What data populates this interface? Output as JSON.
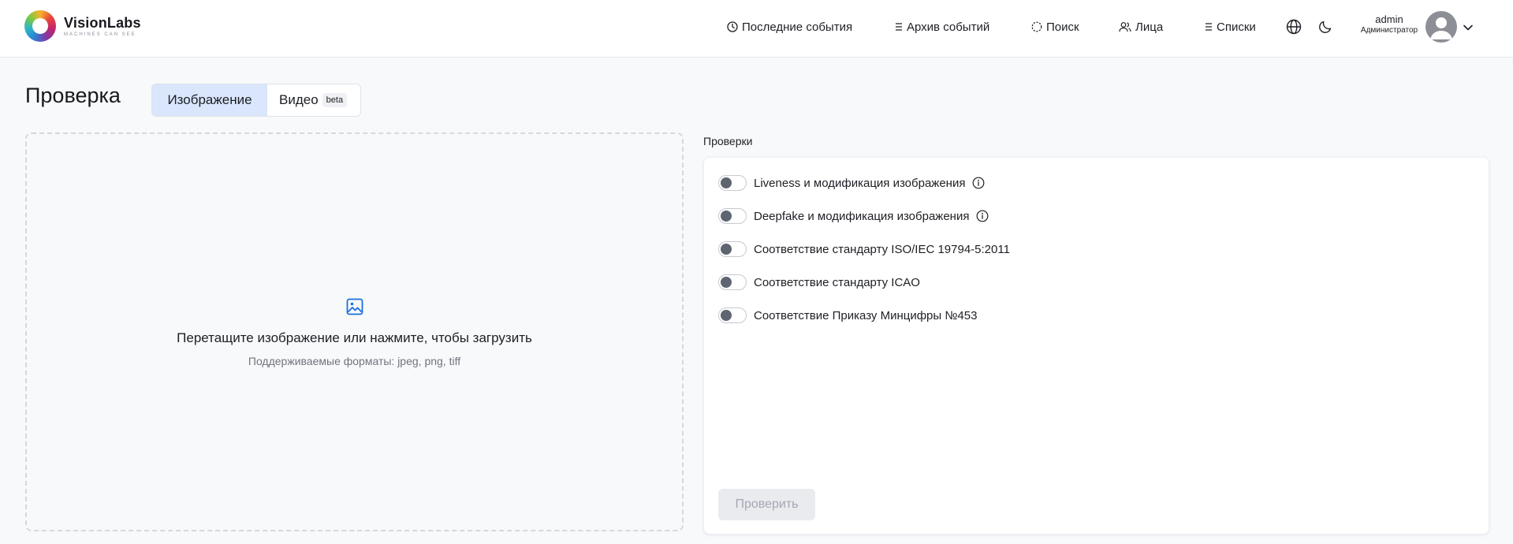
{
  "brand": {
    "name": "VisionLabs",
    "tagline": "MACHINES CAN SEE"
  },
  "nav": {
    "items": [
      {
        "label": "Последние события",
        "icon": "clock-icon"
      },
      {
        "label": "Архив событий",
        "icon": "list-icon"
      },
      {
        "label": "Поиск",
        "icon": "search-target-icon"
      },
      {
        "label": "Лица",
        "icon": "users-icon"
      },
      {
        "label": "Списки",
        "icon": "list-icon"
      }
    ],
    "language_icon": "globe-icon",
    "theme_icon": "moon-icon"
  },
  "user": {
    "name": "admin",
    "role": "Администратор"
  },
  "page": {
    "title": "Проверка",
    "tabs": [
      {
        "label": "Изображение",
        "active": true
      },
      {
        "label": "Видео",
        "badge": "beta",
        "active": false
      }
    ]
  },
  "dropzone": {
    "icon": "image-icon",
    "text": "Перетащите изображение или нажмите, чтобы загрузить",
    "hint": "Поддерживаемые форматы: jpeg, png, tiff"
  },
  "checks": {
    "label": "Проверки",
    "items": [
      {
        "label": "Liveness и модификация изображения",
        "enabled": false,
        "info": true
      },
      {
        "label": "Deepfake и модификация изображения",
        "enabled": false,
        "info": true
      },
      {
        "label": "Соответствие стандарту ISO/IEC 19794-5:2011",
        "enabled": false,
        "info": false
      },
      {
        "label": "Соответствие стандарту ICAO",
        "enabled": false,
        "info": false
      },
      {
        "label": "Соответствие Приказу Минцифры №453",
        "enabled": false,
        "info": false
      }
    ],
    "submit_label": "Проверить",
    "submit_disabled": true
  },
  "colors": {
    "accent": "#1a6fe0",
    "tab_active_bg": "#d9e6fb",
    "page_bg": "#f8f9fb"
  }
}
